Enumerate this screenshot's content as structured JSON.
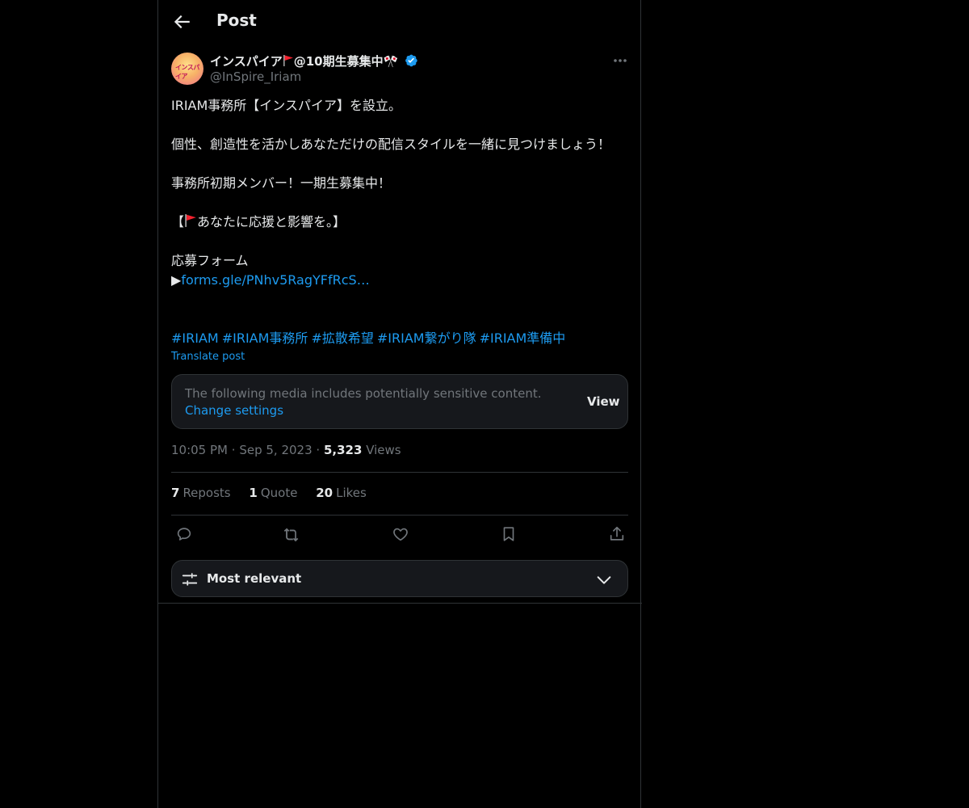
{
  "header": {
    "title": "Post"
  },
  "author": {
    "avatar_text": "インスパイア",
    "name_prefix": "インスパイア",
    "name_suffix": "@10期生募集中",
    "name_emoji": "🎌",
    "handle": "@InSpire_Iriam"
  },
  "post": {
    "line1": "IRIAM事務所【インスパイア】を設立。",
    "line2": "個性、創造性を活かしあなただけの配信スタイルを一緒に見つけましょう！",
    "line3": "事務所初期メンバー！一期生募集中！",
    "line4_prefix": "【",
    "line4_suffix": "あなたに応援と影響を。】",
    "line5": "応募フォーム",
    "link_prefix": "▶",
    "link_text": "forms.gle/PNhv5RagYFfRcS…",
    "hashtags": [
      "#IRIAM",
      "#IRIAM事務所",
      "#拡散希望",
      "#IRIAM繋がり隊",
      "#IRIAM準備中"
    ],
    "translate_label": "Translate post"
  },
  "sensitive": {
    "text": "The following media includes potentially sensitive content.",
    "settings_link": "Change settings",
    "view_label": "View"
  },
  "meta": {
    "time": "10:05 PM",
    "sep": "·",
    "date": "Sep 5, 2023",
    "views_count": "5,323",
    "views_label": "Views"
  },
  "stats": {
    "reposts_count": "7",
    "reposts_label": "Reposts",
    "quotes_count": "1",
    "quotes_label": "Quote",
    "likes_count": "20",
    "likes_label": "Likes"
  },
  "sort": {
    "label": "Most relevant"
  },
  "colors": {
    "accent": "#1d9bf0",
    "muted": "#71767b",
    "flag": "#f4212e"
  }
}
